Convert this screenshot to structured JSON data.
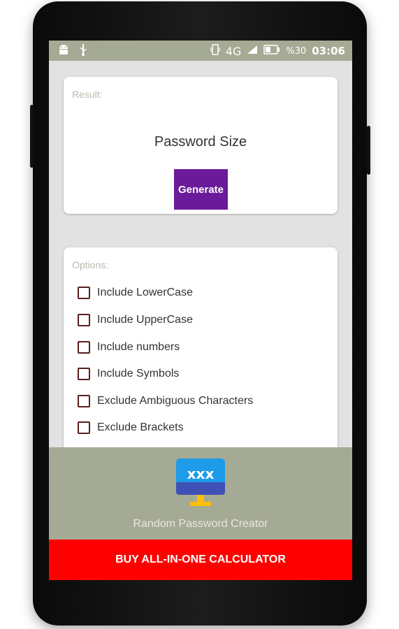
{
  "status_bar": {
    "network": "4G",
    "battery": "%30",
    "time": "03:06"
  },
  "result_card": {
    "title": "Result:",
    "password_size_label": "Password Size",
    "generate_label": "Generate"
  },
  "options_card": {
    "title": "Options:",
    "items": [
      {
        "label": "Include LowerCase",
        "checked": false
      },
      {
        "label": "Include UpperCase",
        "checked": false
      },
      {
        "label": "Include numbers",
        "checked": false
      },
      {
        "label": "Include Symbols",
        "checked": false
      },
      {
        "label": "Exclude Ambiguous Characters",
        "checked": false
      },
      {
        "label": "Exclude Brackets",
        "checked": false
      }
    ]
  },
  "footer": {
    "logo_text": "xxx",
    "app_name": "Random Password Creator"
  },
  "buy_button": {
    "label": "BUY ALL-IN-ONE CALCULATOR"
  },
  "colors": {
    "status_bar": "#a5aa94",
    "generate_button": "#6a1b9a",
    "buy_bar": "#ff0000"
  }
}
